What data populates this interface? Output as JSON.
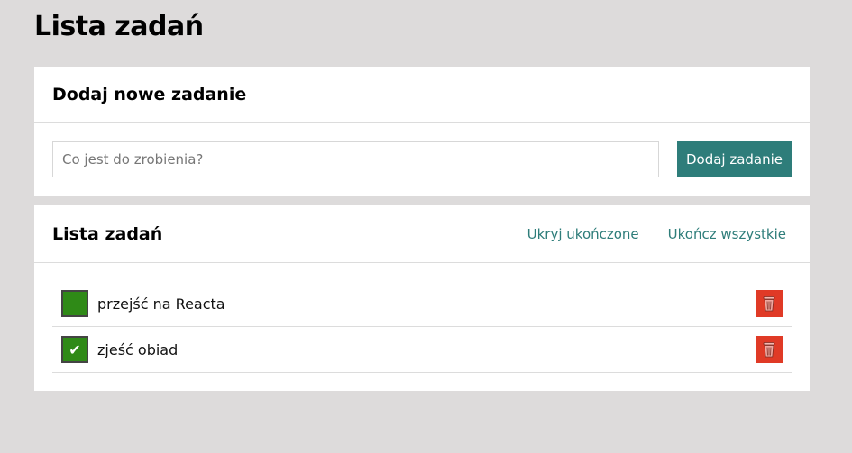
{
  "page": {
    "title": "Lista zadań"
  },
  "add_panel": {
    "title": "Dodaj nowe zadanie",
    "input_placeholder": "Co jest do zrobienia?",
    "input_value": "",
    "button_label": "Dodaj zadanie"
  },
  "list_panel": {
    "title": "Lista zadań",
    "hide_completed_label": "Ukryj ukończone",
    "complete_all_label": "Ukończ wszystkie",
    "tasks": [
      {
        "text": "przejść na Reacta",
        "done": false,
        "check_mark": ""
      },
      {
        "text": "zjeść obiad",
        "done": true,
        "check_mark": "✔"
      }
    ]
  },
  "colors": {
    "background": "#dddbdb",
    "accent": "#2e7d7a",
    "checkbox": "#2f8a17",
    "delete": "#e03a26"
  },
  "icons": {
    "delete": "trash-icon",
    "check": "check-icon"
  }
}
